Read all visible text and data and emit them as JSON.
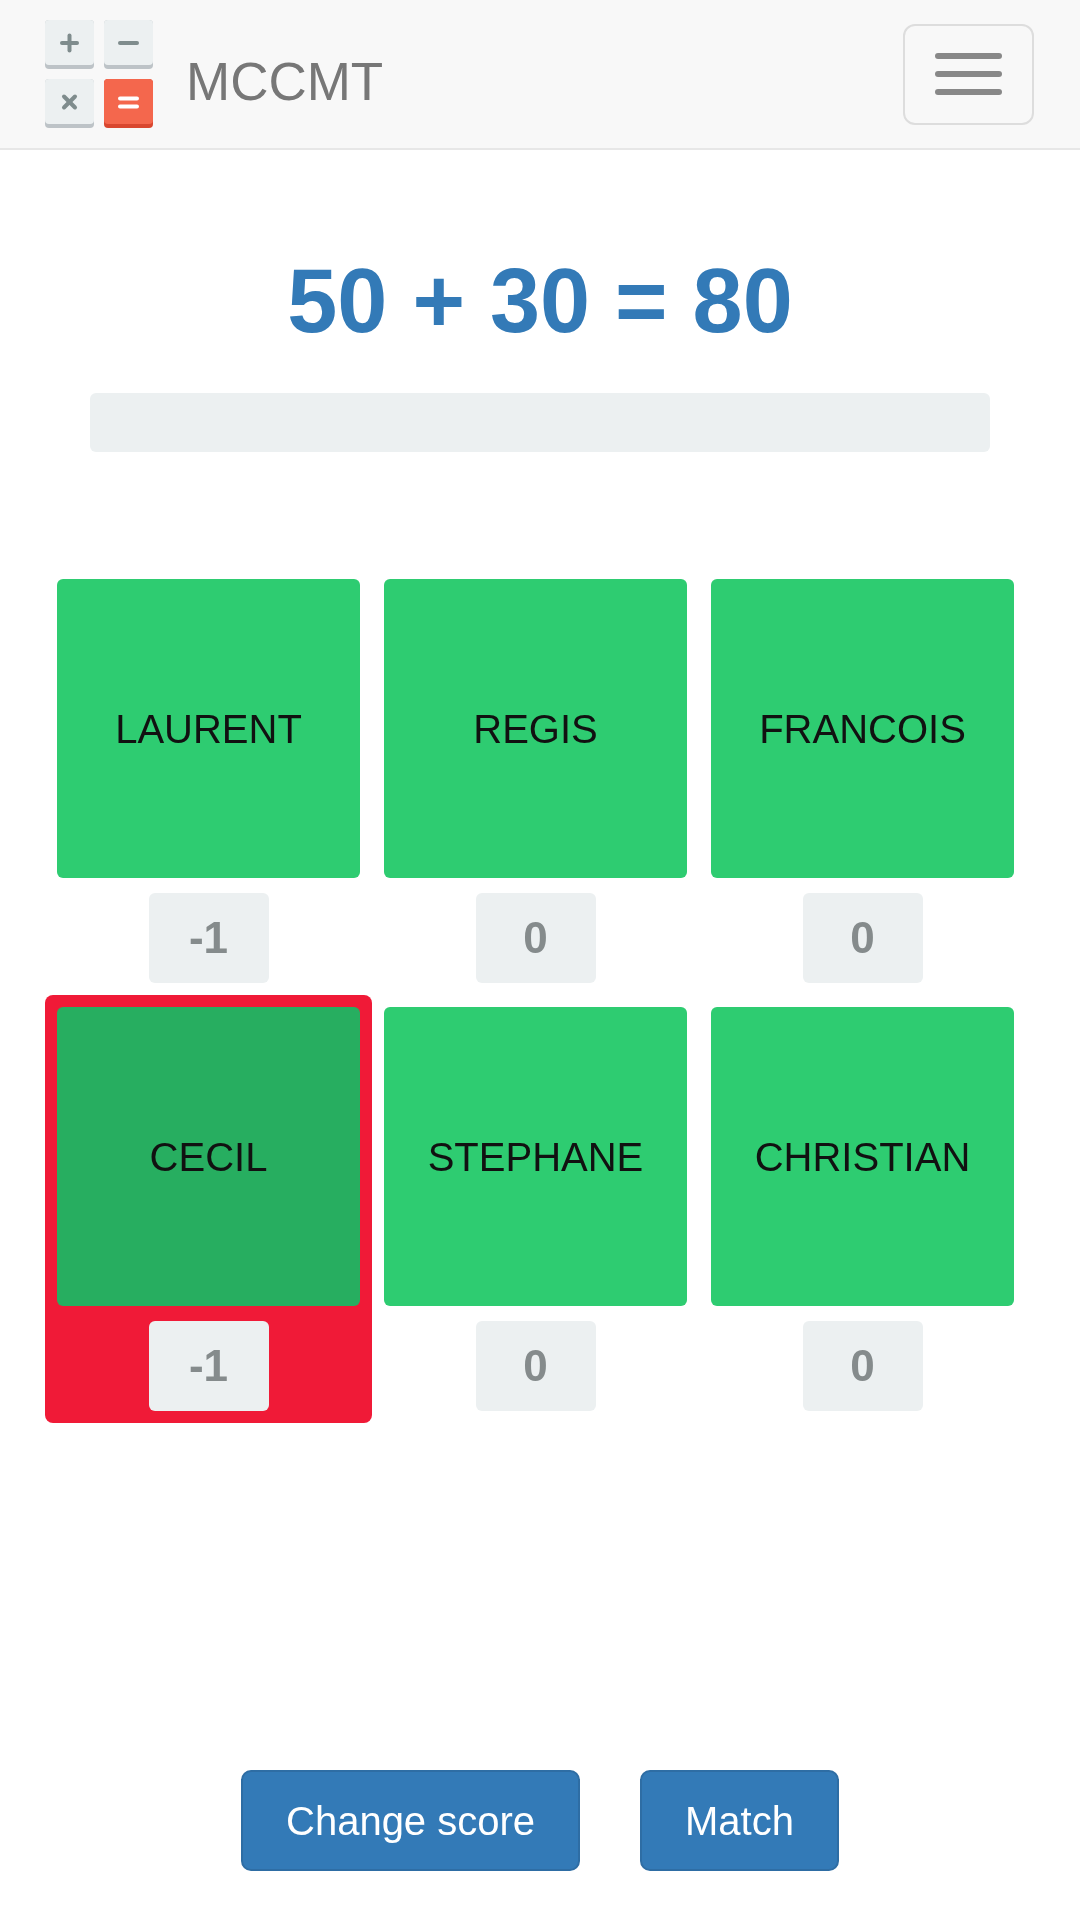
{
  "navbar": {
    "brand": "MCCMT"
  },
  "equation": "50 + 30 = 80",
  "players": [
    {
      "name": "LAURENT",
      "score": "-1",
      "selected": false
    },
    {
      "name": "REGIS",
      "score": "0",
      "selected": false
    },
    {
      "name": "FRANCOIS",
      "score": "0",
      "selected": false
    },
    {
      "name": "CECIL",
      "score": "-1",
      "selected": true
    },
    {
      "name": "STEPHANE",
      "score": "0",
      "selected": false
    },
    {
      "name": "CHRISTIAN",
      "score": "0",
      "selected": false
    }
  ],
  "buttons": [
    {
      "label": "Change score"
    },
    {
      "label": "Match"
    }
  ]
}
